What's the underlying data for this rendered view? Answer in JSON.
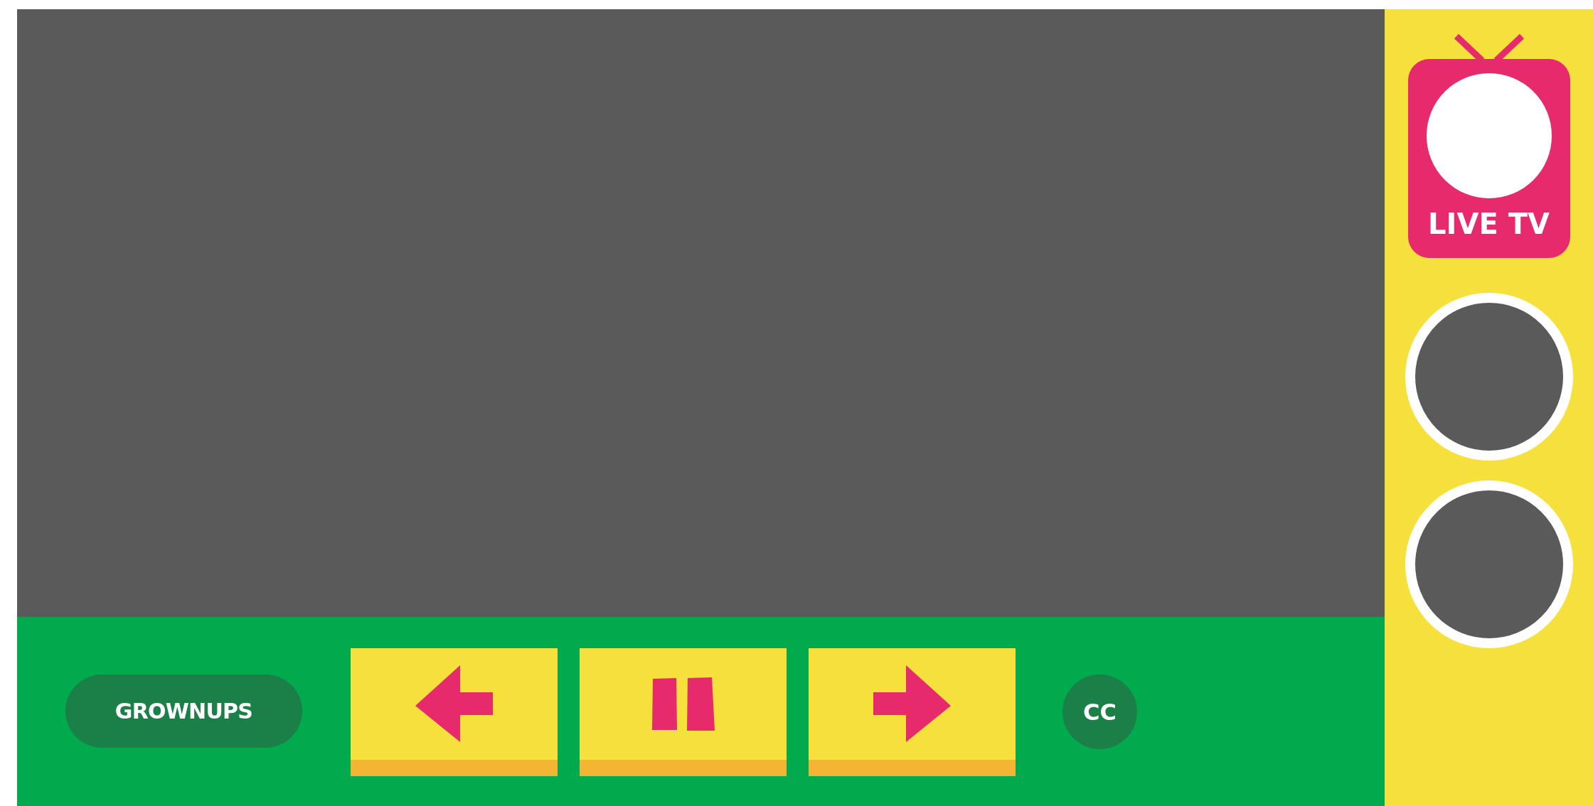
{
  "player": {
    "kind": "empty"
  },
  "grownups_button": {
    "label": "GROWNUPS"
  },
  "controls": [
    {
      "kind": "previous"
    },
    {
      "kind": "pause"
    },
    {
      "kind": "next"
    }
  ],
  "captions_button": {
    "label": "CC"
  },
  "live_tv": {
    "label": "LIVE TV"
  },
  "channels": [
    {
      "kind": "empty"
    },
    {
      "kind": "empty"
    }
  ]
}
